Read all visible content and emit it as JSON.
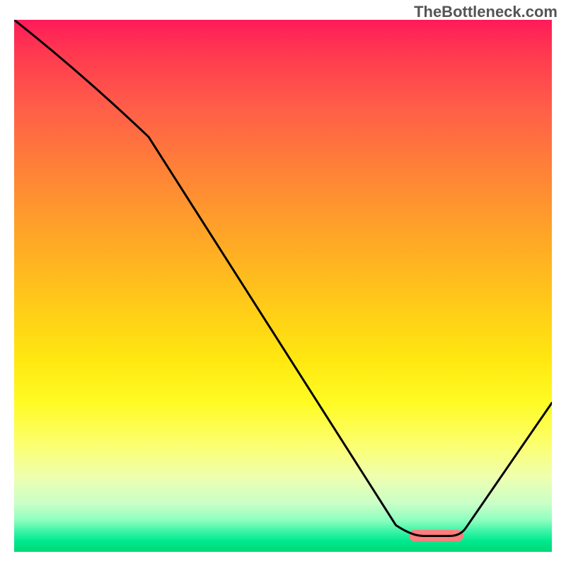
{
  "watermark_text": "TheBottleneck.com",
  "chart_data": {
    "type": "line",
    "title": "",
    "xlabel": "",
    "ylabel": "",
    "xlim": [
      0,
      100
    ],
    "ylim": [
      0,
      100
    ],
    "grid": false,
    "legend": false,
    "x": [
      0,
      25,
      74,
      83,
      100
    ],
    "values": [
      100,
      78,
      3,
      3,
      28
    ],
    "marker": {
      "x_start": 74,
      "x_end": 83,
      "y": 3
    },
    "background_gradient": {
      "stops": [
        {
          "pos": 0.0,
          "color": "#ff1a5a"
        },
        {
          "pos": 0.5,
          "color": "#ffc61a"
        },
        {
          "pos": 0.8,
          "color": "#fcff70"
        },
        {
          "pos": 1.0,
          "color": "#00d876"
        }
      ]
    }
  }
}
